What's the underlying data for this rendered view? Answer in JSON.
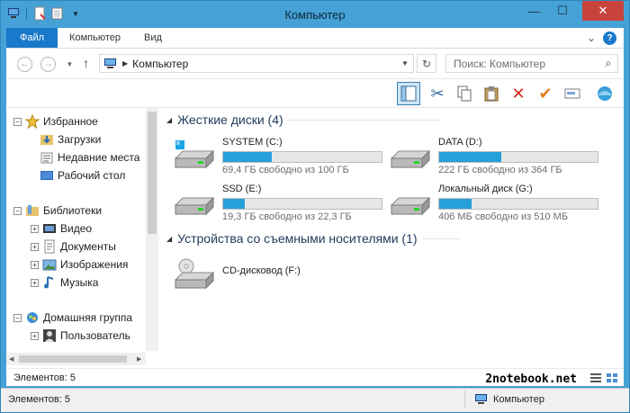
{
  "window": {
    "title": "Компьютер",
    "min_glyph": "—",
    "max_glyph": "☐",
    "close_glyph": "✕"
  },
  "ribbon": {
    "tabs": [
      {
        "label": "Файл"
      },
      {
        "label": "Компьютер"
      },
      {
        "label": "Вид"
      }
    ],
    "help_glyph": "?",
    "collapse_glyph": "⌄"
  },
  "address": {
    "path": "Компьютер",
    "search_placeholder": "Поиск: Компьютер"
  },
  "nav_tree": {
    "favorites": {
      "label": "Избранное",
      "children": [
        "Загрузки",
        "Недавние места",
        "Рабочий стол"
      ]
    },
    "libraries": {
      "label": "Библиотеки",
      "children": [
        "Видео",
        "Документы",
        "Изображения",
        "Музыка"
      ]
    },
    "homegroup": {
      "label": "Домашняя группа",
      "children": [
        "Пользователь"
      ]
    }
  },
  "groups": {
    "hard_drives": "Жесткие диски (4)",
    "removable": "Устройства со съемными носителями (1)"
  },
  "drives": [
    {
      "name": "SYSTEM (C:)",
      "free": "69,4 ГБ свободно из 100 ГБ",
      "used_fraction": 0.306
    },
    {
      "name": "DATA (D:)",
      "free": "222 ГБ свободно из 364 ГБ",
      "used_fraction": 0.39
    },
    {
      "name": "SSD (E:)",
      "free": "19,3 ГБ свободно из 22,3 ГБ",
      "used_fraction": 0.135
    },
    {
      "name": "Локальный диск (G:)",
      "free": "406 МБ свободно из 510 МБ",
      "used_fraction": 0.204
    }
  ],
  "removable_drives": [
    {
      "name": "CD-дисковод (F:)"
    }
  ],
  "status": {
    "inner_items": "Элементов: 5",
    "items": "Элементов: 5",
    "location": "Компьютер"
  },
  "watermark": "2notebook.net",
  "colors": {
    "accent": "#1979ca",
    "titlebar": "#45a1d6",
    "close": "#c7433c",
    "bar_fill": "#26a0da",
    "group_header": "#1e395b"
  }
}
